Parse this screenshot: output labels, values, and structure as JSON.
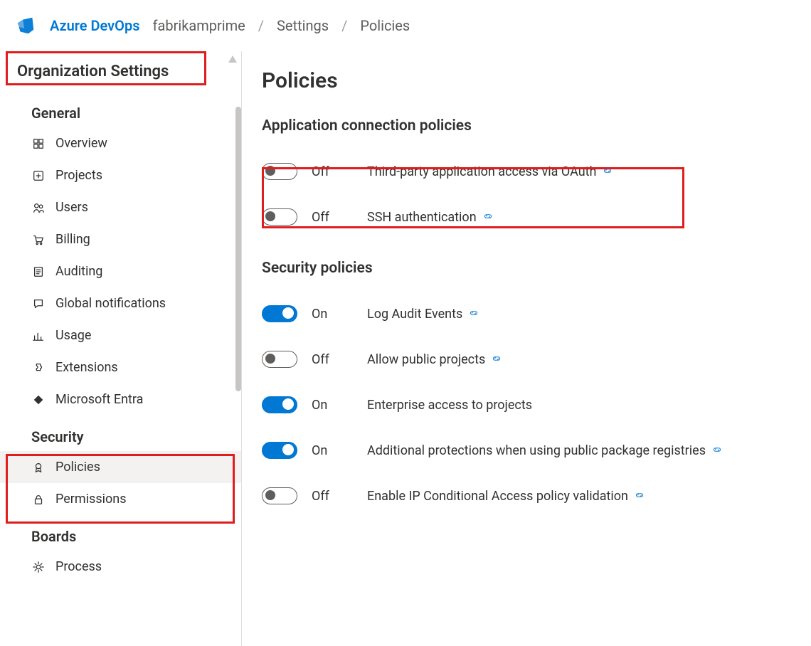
{
  "header": {
    "brand": "Azure DevOps",
    "crumbs": [
      "fabrikamprime",
      "Settings",
      "Policies"
    ]
  },
  "sidebar": {
    "title": "Organization Settings",
    "sections": [
      {
        "heading": "General",
        "items": [
          {
            "icon": "grid",
            "label": "Overview"
          },
          {
            "icon": "plus-box",
            "label": "Projects"
          },
          {
            "icon": "people",
            "label": "Users"
          },
          {
            "icon": "cart",
            "label": "Billing"
          },
          {
            "icon": "receipt",
            "label": "Auditing"
          },
          {
            "icon": "comment",
            "label": "Global notifications"
          },
          {
            "icon": "chart",
            "label": "Usage"
          },
          {
            "icon": "puzzle",
            "label": "Extensions"
          },
          {
            "icon": "diamond",
            "label": "Microsoft Entra"
          }
        ]
      },
      {
        "heading": "Security",
        "items": [
          {
            "icon": "rosette",
            "label": "Policies",
            "active": true
          },
          {
            "icon": "lock",
            "label": "Permissions"
          }
        ]
      },
      {
        "heading": "Boards",
        "items": [
          {
            "icon": "gear",
            "label": "Process"
          }
        ]
      }
    ]
  },
  "main": {
    "title": "Policies",
    "groups": [
      {
        "heading": "Application connection policies",
        "policies": [
          {
            "on": false,
            "state": "Off",
            "label": "Third-party application access via OAuth",
            "has_link": true
          },
          {
            "on": false,
            "state": "Off",
            "label": "SSH authentication",
            "has_link": true
          }
        ]
      },
      {
        "heading": "Security policies",
        "policies": [
          {
            "on": true,
            "state": "On",
            "label": "Log Audit Events",
            "has_link": true
          },
          {
            "on": false,
            "state": "Off",
            "label": "Allow public projects",
            "has_link": true
          },
          {
            "on": true,
            "state": "On",
            "label": "Enterprise access to projects",
            "has_link": false
          },
          {
            "on": true,
            "state": "On",
            "label": "Additional protections when using public package registries",
            "has_link": true
          },
          {
            "on": false,
            "state": "Off",
            "label": "Enable IP Conditional Access policy validation",
            "has_link": true
          }
        ]
      }
    ]
  }
}
